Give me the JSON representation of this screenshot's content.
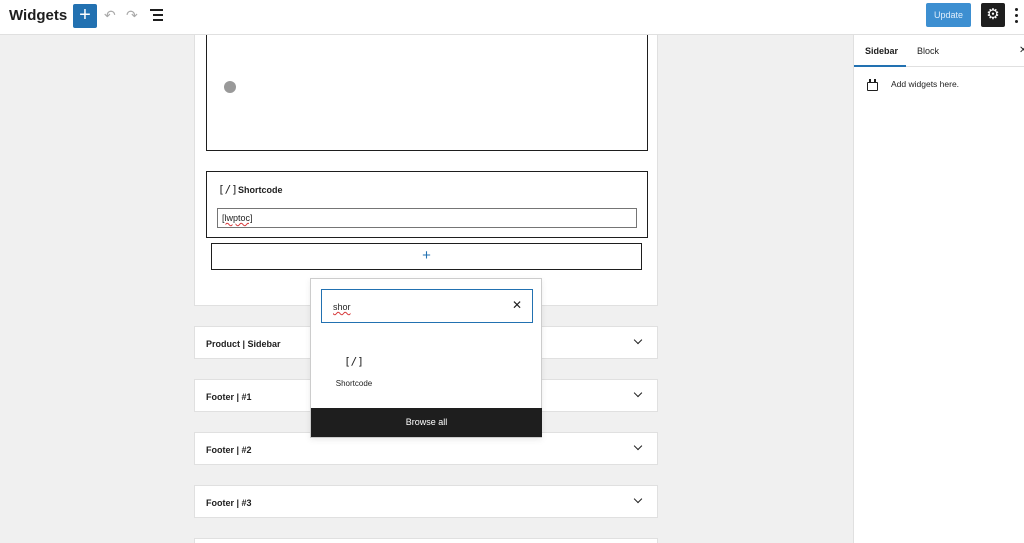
{
  "header": {
    "title": "Widgets",
    "add_icon": "+",
    "undo_icon": "↶",
    "redo_icon": "↷",
    "update_label": "Update",
    "settings_icon": "⚙"
  },
  "colors": {
    "accent": "#2271b1",
    "dark": "#1e1e1e"
  },
  "editor": {
    "shortcode_block": {
      "icon": "[/]",
      "title": "Shortcode",
      "value": "[lwptoc]"
    },
    "appender_icon": "+",
    "widget_areas": [
      {
        "label": "Product | Sidebar"
      },
      {
        "label": "Footer | #1"
      },
      {
        "label": "Footer | #2"
      },
      {
        "label": "Footer | #3"
      }
    ]
  },
  "inserter": {
    "search_value": "shor",
    "clear_icon": "✕",
    "results": [
      {
        "icon": "[/]",
        "label": "Shortcode"
      }
    ],
    "browse_all_label": "Browse all"
  },
  "sidebar": {
    "tabs": [
      "Sidebar",
      "Block"
    ],
    "close_icon": "✕",
    "description": "Add widgets here."
  }
}
